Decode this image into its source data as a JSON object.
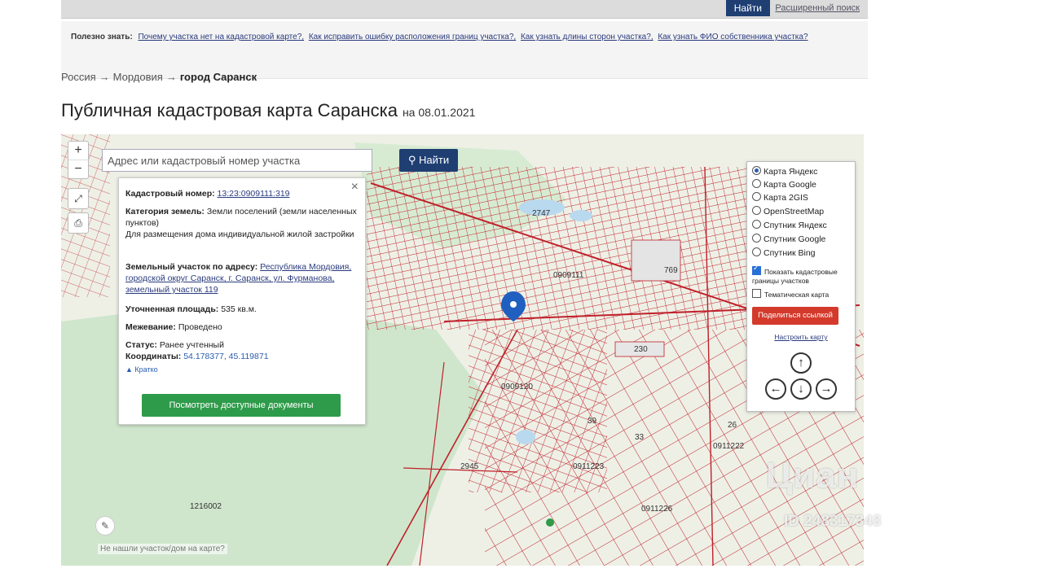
{
  "top": {
    "find_label": "Найти",
    "link_label": "Расширенный поиск"
  },
  "notice": {
    "lead": "Полезно знать:",
    "links": [
      "Почему участка нет на кадастровой карте?,",
      "Как исправить ошибку расположения границ участка?,",
      "Как узнать длины сторон участка?,",
      "Как узнать ФИО собственника участка?"
    ]
  },
  "breadcrumbs": {
    "items": [
      "Россия",
      "Мордовия"
    ],
    "current": "город Саранск",
    "separator": "→"
  },
  "title": {
    "text": "Публичная кадастровая карта Саранска",
    "date": "на 08.01.2021"
  },
  "search": {
    "placeholder": "Адрес или кадастровый номер участка",
    "find_label": "Найти"
  },
  "info": {
    "cadastral_label": "Кадастровый номер:",
    "cadastral_value": "13:23:0909111:319",
    "category_label": "Категория земель:",
    "category_value": "Земли поселений (земли населенных пунктов)",
    "purpose": "Для размещения дома индивидуальной жилой застройки",
    "address_label": "Земельный участок по адресу:",
    "address_value": "Республика Мордовия, городской округ Саранск, г. Саранск, ул. Фурманова, земельный участок 119",
    "area_label": "Уточненная площадь:",
    "area_value": "535 кв.м.",
    "survey_label": "Межевание:",
    "survey_value": "Проведено",
    "status_label": "Статус:",
    "status_value": "Ранее учтенный",
    "coords_label": "Координаты:",
    "coords_value": "54.178377, 45.119871",
    "brief_label": "▲ Кратко",
    "docs_button": "Посмотреть доступные документы"
  },
  "layers": {
    "items": [
      "Карта Яндекс",
      "Карта Google",
      "Карта 2GIS",
      "OpenStreetMap",
      "Спутник Яндекс",
      "Спутник Google",
      "Спутник Bing"
    ],
    "selected": 0,
    "show_borders": "Показать кадастровые границы участков",
    "thematic": "Тематическая карта",
    "share": "Поделиться ссылкой",
    "setup": "Настроить карту"
  },
  "map": {
    "labels": [
      "1216002",
      "0909111",
      "0909120",
      "0911222",
      "0911226",
      "0911223",
      "2747",
      "2945",
      "769",
      "230",
      "39",
      "33",
      "26"
    ],
    "not_found": "Не нашли участок/дом на карте?"
  },
  "watermark": {
    "brand": "Циан",
    "id": "ID 248317348"
  },
  "colors": {
    "accent": "#1f3f73",
    "share": "#d33a2c",
    "docs": "#2e9b4a",
    "parcel_line": "#c0202a"
  }
}
